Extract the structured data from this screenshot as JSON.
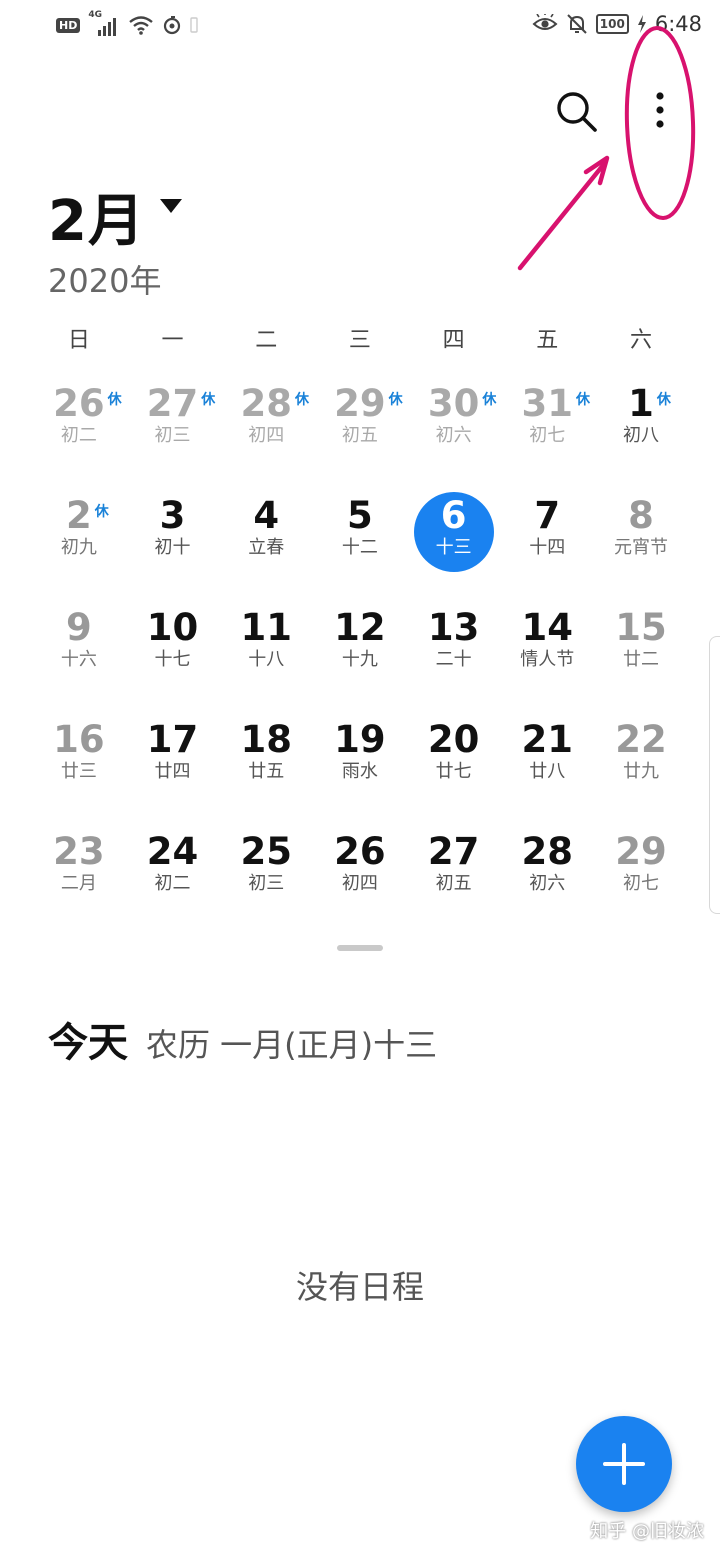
{
  "status_bar": {
    "hd": "HD",
    "network": "4G",
    "battery": "100",
    "time": "6:48"
  },
  "header": {
    "month": "2月",
    "year": "2020年"
  },
  "weekdays": [
    "日",
    "一",
    "二",
    "三",
    "四",
    "五",
    "六"
  ],
  "calendar": [
    {
      "day": "26",
      "lunar": "初二",
      "badge": "休",
      "kind": "other"
    },
    {
      "day": "27",
      "lunar": "初三",
      "badge": "休",
      "kind": "other"
    },
    {
      "day": "28",
      "lunar": "初四",
      "badge": "休",
      "kind": "other"
    },
    {
      "day": "29",
      "lunar": "初五",
      "badge": "休",
      "kind": "other"
    },
    {
      "day": "30",
      "lunar": "初六",
      "badge": "休",
      "kind": "other"
    },
    {
      "day": "31",
      "lunar": "初七",
      "badge": "休",
      "kind": "other"
    },
    {
      "day": "1",
      "lunar": "初八",
      "badge": "休",
      "kind": "normal"
    },
    {
      "day": "2",
      "lunar": "初九",
      "badge": "休",
      "kind": "weekend"
    },
    {
      "day": "3",
      "lunar": "初十",
      "badge": "",
      "kind": "normal"
    },
    {
      "day": "4",
      "lunar": "立春",
      "badge": "",
      "kind": "normal"
    },
    {
      "day": "5",
      "lunar": "十二",
      "badge": "",
      "kind": "normal"
    },
    {
      "day": "6",
      "lunar": "十三",
      "badge": "",
      "kind": "today"
    },
    {
      "day": "7",
      "lunar": "十四",
      "badge": "",
      "kind": "normal"
    },
    {
      "day": "8",
      "lunar": "元宵节",
      "badge": "",
      "kind": "weekend"
    },
    {
      "day": "9",
      "lunar": "十六",
      "badge": "",
      "kind": "weekend"
    },
    {
      "day": "10",
      "lunar": "十七",
      "badge": "",
      "kind": "normal"
    },
    {
      "day": "11",
      "lunar": "十八",
      "badge": "",
      "kind": "normal"
    },
    {
      "day": "12",
      "lunar": "十九",
      "badge": "",
      "kind": "normal"
    },
    {
      "day": "13",
      "lunar": "二十",
      "badge": "",
      "kind": "normal"
    },
    {
      "day": "14",
      "lunar": "情人节",
      "badge": "",
      "kind": "normal"
    },
    {
      "day": "15",
      "lunar": "廿二",
      "badge": "",
      "kind": "weekend"
    },
    {
      "day": "16",
      "lunar": "廿三",
      "badge": "",
      "kind": "weekend"
    },
    {
      "day": "17",
      "lunar": "廿四",
      "badge": "",
      "kind": "normal"
    },
    {
      "day": "18",
      "lunar": "廿五",
      "badge": "",
      "kind": "normal"
    },
    {
      "day": "19",
      "lunar": "雨水",
      "badge": "",
      "kind": "normal"
    },
    {
      "day": "20",
      "lunar": "廿七",
      "badge": "",
      "kind": "normal"
    },
    {
      "day": "21",
      "lunar": "廿八",
      "badge": "",
      "kind": "normal"
    },
    {
      "day": "22",
      "lunar": "廿九",
      "badge": "",
      "kind": "weekend"
    },
    {
      "day": "23",
      "lunar": "二月",
      "badge": "",
      "kind": "weekend"
    },
    {
      "day": "24",
      "lunar": "初二",
      "badge": "",
      "kind": "normal"
    },
    {
      "day": "25",
      "lunar": "初三",
      "badge": "",
      "kind": "normal"
    },
    {
      "day": "26",
      "lunar": "初四",
      "badge": "",
      "kind": "normal"
    },
    {
      "day": "27",
      "lunar": "初五",
      "badge": "",
      "kind": "normal"
    },
    {
      "day": "28",
      "lunar": "初六",
      "badge": "",
      "kind": "normal"
    },
    {
      "day": "29",
      "lunar": "初七",
      "badge": "",
      "kind": "weekend"
    }
  ],
  "today_section": {
    "label": "今天",
    "lunar": "农历 一月(正月)十三"
  },
  "empty_state": "没有日程",
  "watermark": "知乎 @旧妆浓",
  "icons": {
    "search": "search-icon",
    "more": "more-vertical-icon",
    "dropdown": "triangle-down-icon",
    "add": "plus-icon"
  },
  "colors": {
    "accent": "#1a82f0",
    "holiday_badge": "#1a82d8",
    "annotation": "#d8126e"
  }
}
